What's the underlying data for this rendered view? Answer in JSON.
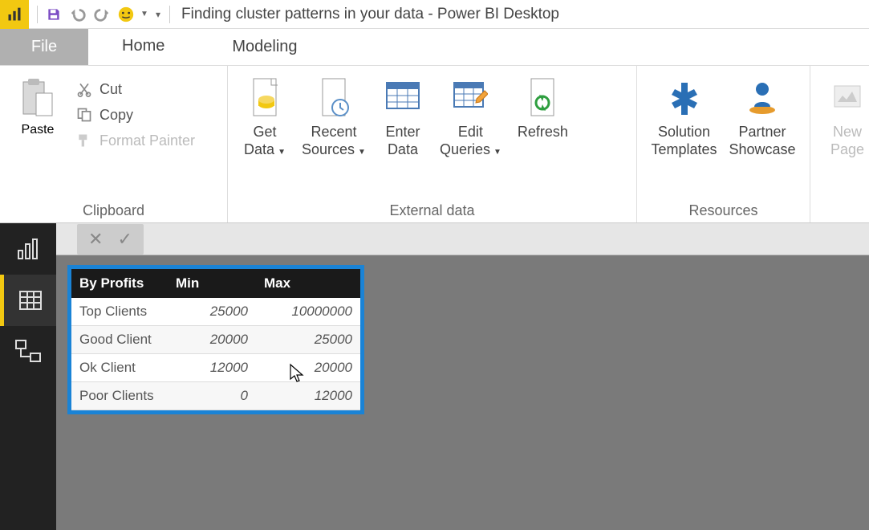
{
  "title": "Finding cluster patterns in your data - Power BI Desktop",
  "tabs": {
    "file": "File",
    "home": "Home",
    "modeling": "Modeling"
  },
  "clipboard": {
    "paste": "Paste",
    "cut": "Cut",
    "copy": "Copy",
    "format_painter": "Format Painter",
    "group_label": "Clipboard"
  },
  "external": {
    "get_data_1": "Get",
    "get_data_2": "Data",
    "recent_1": "Recent",
    "recent_2": "Sources",
    "enter_1": "Enter",
    "enter_2": "Data",
    "edit_1": "Edit",
    "edit_2": "Queries",
    "refresh": "Refresh",
    "group_label": "External data"
  },
  "resources": {
    "solution_1": "Solution",
    "solution_2": "Templates",
    "partner_1": "Partner",
    "partner_2": "Showcase",
    "group_label": "Resources"
  },
  "insert": {
    "new_1": "New",
    "new_2": "Page"
  },
  "table": {
    "headers": {
      "by_profits": "By Profits",
      "min": "Min",
      "max": "Max"
    },
    "rows": [
      {
        "label": "Top Clients",
        "min": "25000",
        "max": "10000000"
      },
      {
        "label": "Good Client",
        "min": "20000",
        "max": "25000"
      },
      {
        "label": "Ok Client",
        "min": "12000",
        "max": "20000"
      },
      {
        "label": "Poor Clients",
        "min": "0",
        "max": "12000"
      }
    ]
  }
}
